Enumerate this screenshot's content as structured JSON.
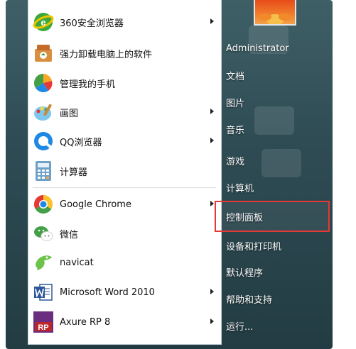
{
  "programs": [
    {
      "label": "360安全浏览器",
      "icon": "360-browser-icon",
      "arrow": true
    },
    {
      "label": "强力卸载电脑上的软件",
      "icon": "uninstaller-icon",
      "arrow": false
    },
    {
      "label": "管理我的手机",
      "icon": "phone-manager-icon",
      "arrow": false
    },
    {
      "label": "画图",
      "icon": "paint-icon",
      "arrow": true
    },
    {
      "label": "QQ浏览器",
      "icon": "qq-browser-icon",
      "arrow": true
    },
    {
      "label": "计算器",
      "icon": "calculator-icon",
      "arrow": false
    },
    {
      "label": "Google Chrome",
      "icon": "chrome-icon",
      "arrow": true
    },
    {
      "label": "微信",
      "icon": "wechat-icon",
      "arrow": false
    },
    {
      "label": "navicat",
      "icon": "navicat-icon",
      "arrow": false
    },
    {
      "label": "Microsoft Word 2010",
      "icon": "word-icon",
      "arrow": true
    },
    {
      "label": "Axure RP 8",
      "icon": "axure-icon",
      "arrow": true
    }
  ],
  "right_items": [
    {
      "label": "Administrator"
    },
    {
      "label": "文档"
    },
    {
      "label": "图片"
    },
    {
      "label": "音乐"
    },
    {
      "label": "游戏"
    },
    {
      "label": "计算机"
    },
    {
      "label": "控制面板",
      "highlighted": true
    },
    {
      "label": "设备和打印机"
    },
    {
      "label": "默认程序"
    },
    {
      "label": "帮助和支持"
    },
    {
      "label": "运行..."
    }
  ],
  "colors": {
    "highlight_border": "#e53935",
    "menu_background": "#2f4c54"
  }
}
